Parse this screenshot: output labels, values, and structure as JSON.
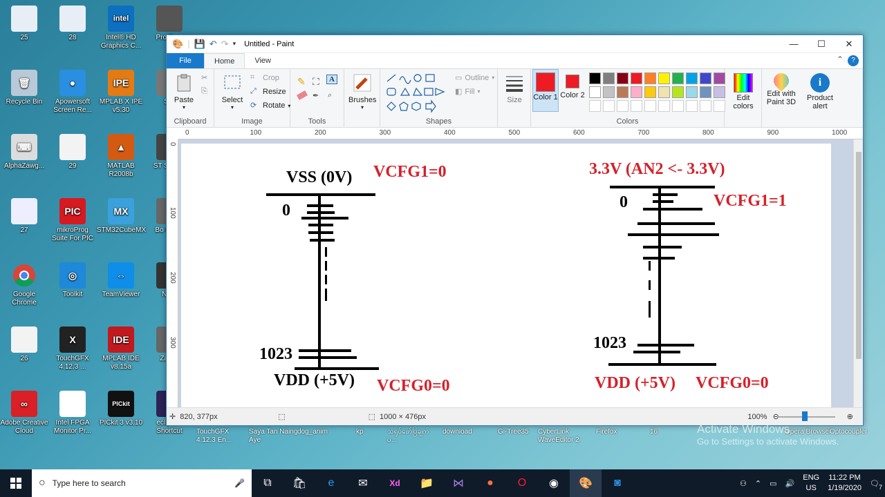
{
  "desktop": {
    "icons": [
      {
        "label": "25",
        "bg": "#e8eef6",
        "glyph": ""
      },
      {
        "label": "28",
        "bg": "#e8eef6",
        "glyph": ""
      },
      {
        "label": "Intel® HD Graphics C...",
        "bg": "#0d6fbf",
        "glyph": "intel"
      },
      {
        "label": "Pro Profi",
        "bg": "#555",
        "glyph": ""
      },
      {
        "label": "Recycle Bin",
        "bg": "#b9c9d8",
        "glyph": "🗑"
      },
      {
        "label": "Apowersoft Screen Re...",
        "bg": "#2a8fe0",
        "glyph": "●"
      },
      {
        "label": "MPLAB X IPE v5.30",
        "bg": "#e47a13",
        "glyph": "IPE"
      },
      {
        "label": "Ser",
        "bg": "#777",
        "glyph": ""
      },
      {
        "label": "AlphaZawg...",
        "bg": "#ddd",
        "glyph": "⌨"
      },
      {
        "label": "29",
        "bg": "#f3f3f3",
        "glyph": ""
      },
      {
        "label": "MATLAB R2008b",
        "bg": "#d35a12",
        "glyph": "▲"
      },
      {
        "label": "ST ST-LIN",
        "bg": "#444",
        "glyph": ""
      },
      {
        "label": "27",
        "bg": "#eef",
        "glyph": ""
      },
      {
        "label": "mikroProg Suite For PIC",
        "bg": "#d71920",
        "glyph": "PIC"
      },
      {
        "label": "STM32CubeMX",
        "bg": "#3aa1dd",
        "glyph": "MX"
      },
      {
        "label": "Bo Printe",
        "bg": "#666",
        "glyph": ""
      },
      {
        "label": "Google Chrome",
        "bg": "#ffffff",
        "glyph": "chrome"
      },
      {
        "label": "Toolkit",
        "bg": "#1e88d9",
        "glyph": "◎"
      },
      {
        "label": "TeamViewer",
        "bg": "#0e8ee9",
        "glyph": "⇔"
      },
      {
        "label": "Nero",
        "bg": "#333",
        "glyph": ""
      },
      {
        "label": "26",
        "bg": "#f3f3f3",
        "glyph": ""
      },
      {
        "label": "TouchGFX 4.12.3 ...",
        "bg": "#222",
        "glyph": "X"
      },
      {
        "label": "MPLAB IDE v8.15a",
        "bg": "#c2191f",
        "glyph": "IDE"
      },
      {
        "label": "Za Ch",
        "bg": "#666",
        "glyph": ""
      },
      {
        "label": "Adobe Creative Cloud",
        "bg": "#da1f26",
        "glyph": "∞"
      },
      {
        "label": "Intel FPGA Monitor Pr...",
        "bg": "#ffffff",
        "glyph": ""
      },
      {
        "label": "PICkit 3 v3.10",
        "bg": "#111",
        "glyph": "PICkit"
      },
      {
        "label": "eclipse - Shortcut",
        "bg": "#2c2255",
        "glyph": "◐"
      }
    ],
    "bottom_labels": [
      "TouchGFX 4.12.3 En...",
      "Saya Tan Naing Aye",
      "dog_anim",
      "kp",
      "သရုပ်ဖော်ပြချက် ပ...",
      "download",
      "Gi-Tree35",
      "CyberLink WaveEditor 2",
      "Firefox",
      "16",
      "Opera Browser",
      "Optocoupler"
    ]
  },
  "paint": {
    "window_title": "Untitled - Paint",
    "tabs": {
      "file": "File",
      "home": "Home",
      "view": "View"
    },
    "clipboard": {
      "paste": "Paste",
      "label": "Clipboard"
    },
    "image": {
      "select": "Select",
      "crop": "Crop",
      "resize": "Resize",
      "rotate": "Rotate",
      "label": "Image"
    },
    "tools": {
      "label": "Tools"
    },
    "brushes": {
      "label": "Brushes"
    },
    "shapes": {
      "outline": "Outline",
      "fill": "Fill",
      "label": "Shapes"
    },
    "size": {
      "label": "Size"
    },
    "colors": {
      "color1": "Color 1",
      "color2": "Color 2",
      "edit": "Edit colors",
      "label": "Colors",
      "color1_value": "#ed1c24",
      "color2_value": "#ed1c24",
      "palette_row1": [
        "#000000",
        "#7f7f7f",
        "#880015",
        "#ed1c24",
        "#ff7f27",
        "#fff200",
        "#22b14c",
        "#00a2e8",
        "#3f48cc",
        "#a349a4"
      ],
      "palette_row2": [
        "#ffffff",
        "#c3c3c3",
        "#b97a57",
        "#ffaec9",
        "#ffc90e",
        "#efe4b0",
        "#b5e61d",
        "#99d9ea",
        "#7092be",
        "#c8bfe7"
      ]
    },
    "paint3d": "Edit with Paint 3D",
    "product_alert": "Product alert",
    "ruler_h": [
      "0",
      "100",
      "200",
      "300",
      "400",
      "500",
      "600",
      "700",
      "800",
      "900",
      "1000"
    ],
    "ruler_v": [
      "0",
      "100",
      "200",
      "300"
    ],
    "status": {
      "cursor": "820, 377px",
      "size": "1000 × 476px",
      "zoom": "100%"
    }
  },
  "drawing": {
    "left": {
      "top_rail": "VSS (0V)",
      "cfg_top": "VCFG1=0",
      "step_top": "0",
      "step_bottom": "1023",
      "bottom_rail": "VDD (+5V)",
      "cfg_bottom": "VCFG0=0"
    },
    "right": {
      "top_rail": "3.3V (AN2 <- 3.3V)",
      "cfg_top": "VCFG1=1",
      "step_top": "0",
      "step_bottom": "1023",
      "bottom_rail": "VDD (+5V)",
      "cfg_bottom": "VCFG0=0"
    }
  },
  "watermark": {
    "line1": "Activate Windows",
    "line2": "Go to Settings to activate Windows."
  },
  "taskbar": {
    "search_placeholder": "Type here to search",
    "time": "11:22 PM",
    "date": "1/19/2020",
    "lang1": "ENG",
    "lang2": "US",
    "notification_count": "7"
  }
}
